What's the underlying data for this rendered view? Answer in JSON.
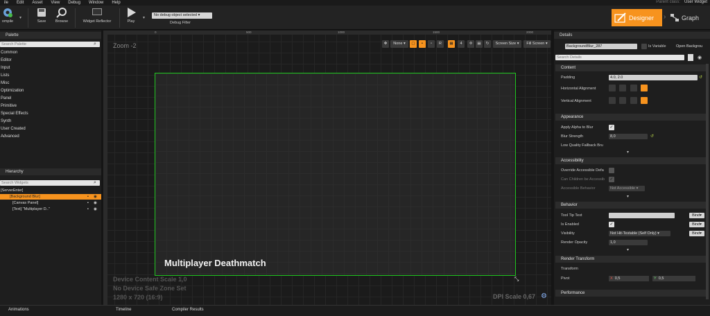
{
  "menubar": {
    "items": [
      "ile",
      "Edit",
      "Asset",
      "View",
      "Debug",
      "Window",
      "Help"
    ],
    "parent_class": "Parent class:",
    "parent_value": "User Widget"
  },
  "toolbar": {
    "compile": "ompile",
    "save": "Save",
    "browse": "Browse",
    "reflector": "Widget Reflector",
    "play": "Play",
    "debug_select": "No debug object selected",
    "debug_filter": "Debug Filter",
    "designer": "Designer",
    "graph": "Graph"
  },
  "palette": {
    "title": "Palette",
    "search_placeholder": "Search Palette",
    "categories": [
      "Common",
      "Editor",
      "Input",
      "Lists",
      "Misc",
      "Optimization",
      "Panel",
      "Primitive",
      "Special Effects",
      "Synth",
      "User Created",
      "Advanced"
    ]
  },
  "hierarchy": {
    "title": "Hierarchy",
    "search_placeholder": "Search Widgets",
    "rows": [
      "[ServerEnter]",
      "[Background Blur]",
      "[Canvas Panel]",
      "[Text] \"Multiplayer D..\""
    ]
  },
  "canvas": {
    "zoom": "Zoom -2",
    "ruler_top": [
      "0",
      "500",
      "1000",
      "1500",
      "2000"
    ],
    "ruler_left": [
      "0",
      "500",
      "1000"
    ],
    "none_label": "None",
    "r_label": "R",
    "four_label": "4",
    "screen_size": "Screen Size",
    "fill_screen": "Fill Screen",
    "widget_text": "Multiplayer Deathmatch",
    "info_lines": [
      "Device Content Scale 1,0",
      "No Device Safe Zone Set",
      "1280 x 720 (16:9)"
    ],
    "dpi": "DPI Scale 0,67"
  },
  "details": {
    "title": "Details",
    "name_value": "BackgroundBlur_287",
    "is_variable": "Is Variable",
    "open": "Open Backgrou",
    "search_placeholder": "Search Details",
    "content": {
      "header": "Content",
      "padding_label": "Padding",
      "padding_value": "4.0, 2.0",
      "halign_label": "Horizontal Alignment",
      "valign_label": "Vertical Alignment"
    },
    "appearance": {
      "header": "Appearance",
      "apply_alpha": "Apply Alpha to Blur",
      "blur_strength": "Blur Strength",
      "blur_value": "8,0",
      "low_quality": "Low Quality Fallback Bru"
    },
    "accessibility": {
      "header": "Accessibility",
      "override": "Override Accessible Defa",
      "can_children": "Can Children be Accessib",
      "behavior_label": "Accessible Behavior",
      "behavior_value": "Not Accessible"
    },
    "behavior": {
      "header": "Behavior",
      "tooltip": "Tool Tip Text",
      "enabled": "Is Enabled",
      "visibility": "Visibility",
      "visibility_value": "Not Hit-Testable (Self Only)",
      "opacity": "Render Opacity",
      "opacity_value": "1,0",
      "bind": "Bind"
    },
    "render": {
      "header": "Render Transform",
      "transform": "Transform",
      "pivot": "Pivot",
      "x_label": "X",
      "x_value": "0,5",
      "y_label": "Y",
      "y_value": "0,5"
    },
    "performance": {
      "header": "Performance"
    }
  },
  "bottom": {
    "animations": "Animations",
    "timeline": "Timeline",
    "compiler": "Compiler Results"
  },
  "colors": {
    "accent": "#f7931e",
    "selection_border": "#1ec61e"
  }
}
